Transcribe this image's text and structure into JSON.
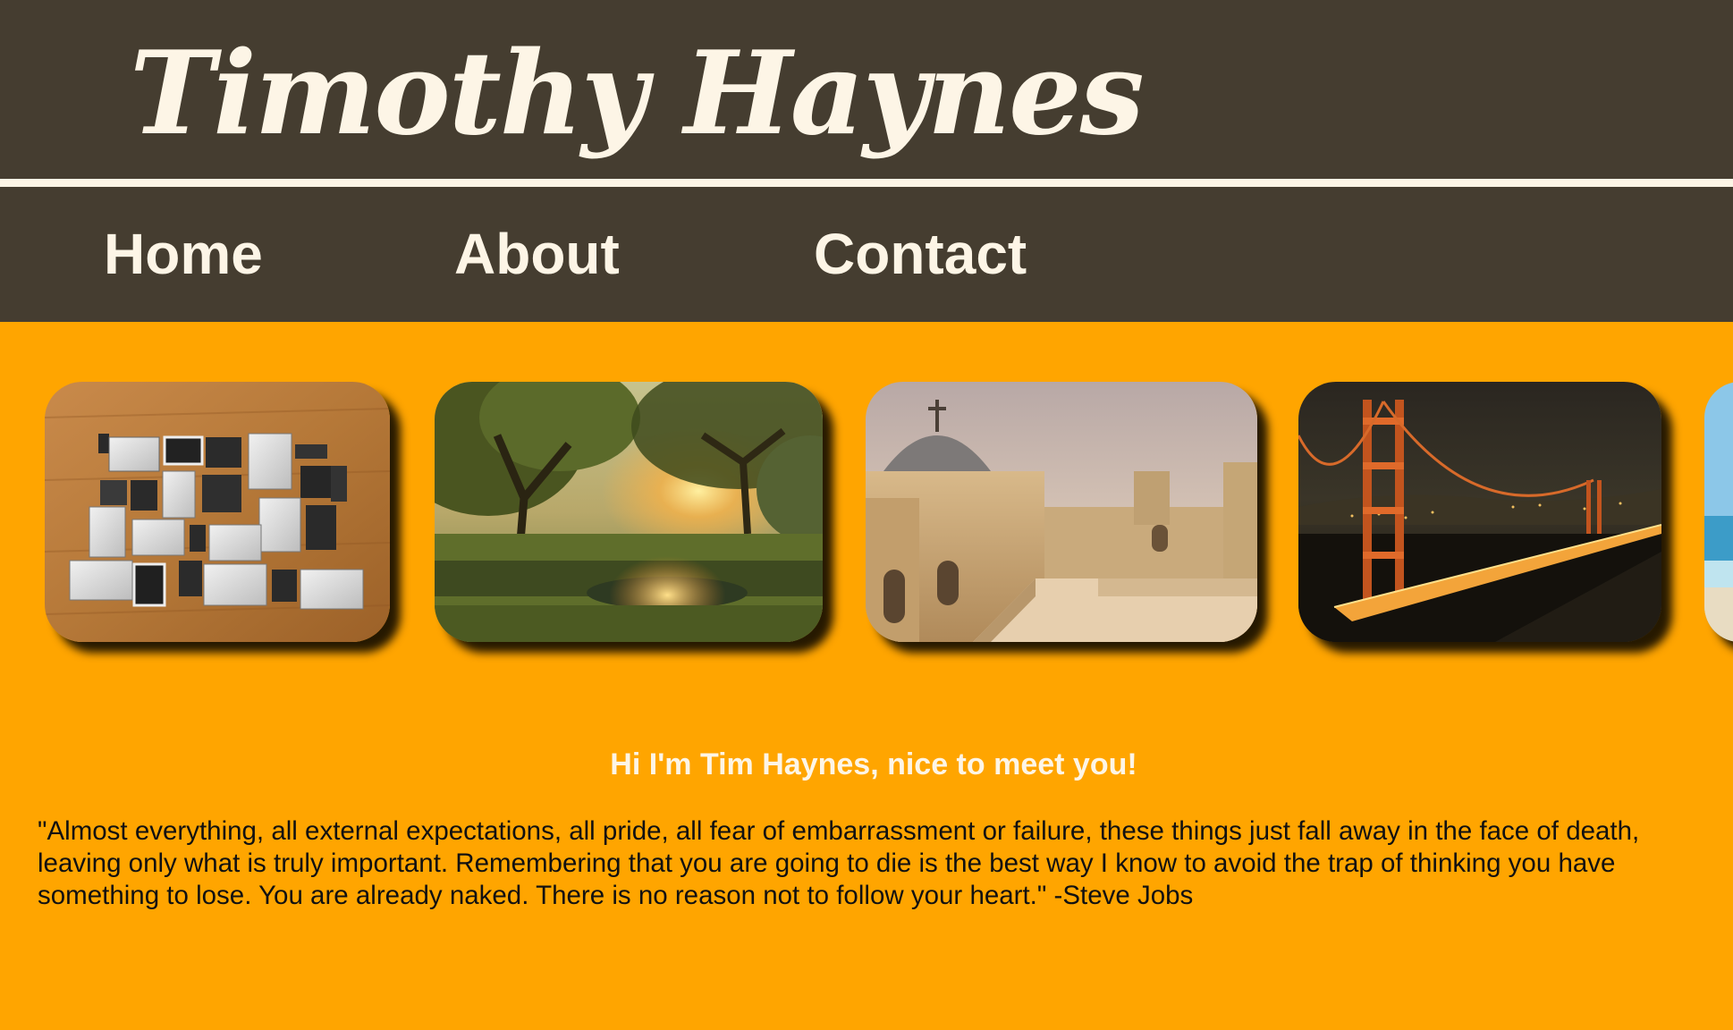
{
  "header": {
    "title": "Timothy Haynes"
  },
  "nav": {
    "items": [
      {
        "label": "Home"
      },
      {
        "label": "About"
      },
      {
        "label": "Contact"
      }
    ]
  },
  "gallery": {
    "photos": [
      {
        "icon": "laptops-photo"
      },
      {
        "icon": "park-sunset-photo"
      },
      {
        "icon": "church-dome-photo"
      },
      {
        "icon": "golden-gate-bridge-photo"
      },
      {
        "icon": "beach-photo"
      }
    ]
  },
  "content": {
    "greeting": "Hi I'm Tim Haynes, nice to meet you!",
    "quote": "\"Almost everything, all external expectations, all pride, all fear of embarrassment or failure, these things just fall away in the face of death, leaving only what is truly important. Remembering that you are going to die is the best way I know to avoid the trap of thinking you have something to lose. You are already naked. There is no reason not to follow your heart.\" -Steve Jobs"
  },
  "colors": {
    "page_background": "#FFA500",
    "header_background": "#453D30",
    "header_text": "#FDF5E6",
    "greeting_text": "#FDF5E6",
    "body_text": "#111111"
  }
}
